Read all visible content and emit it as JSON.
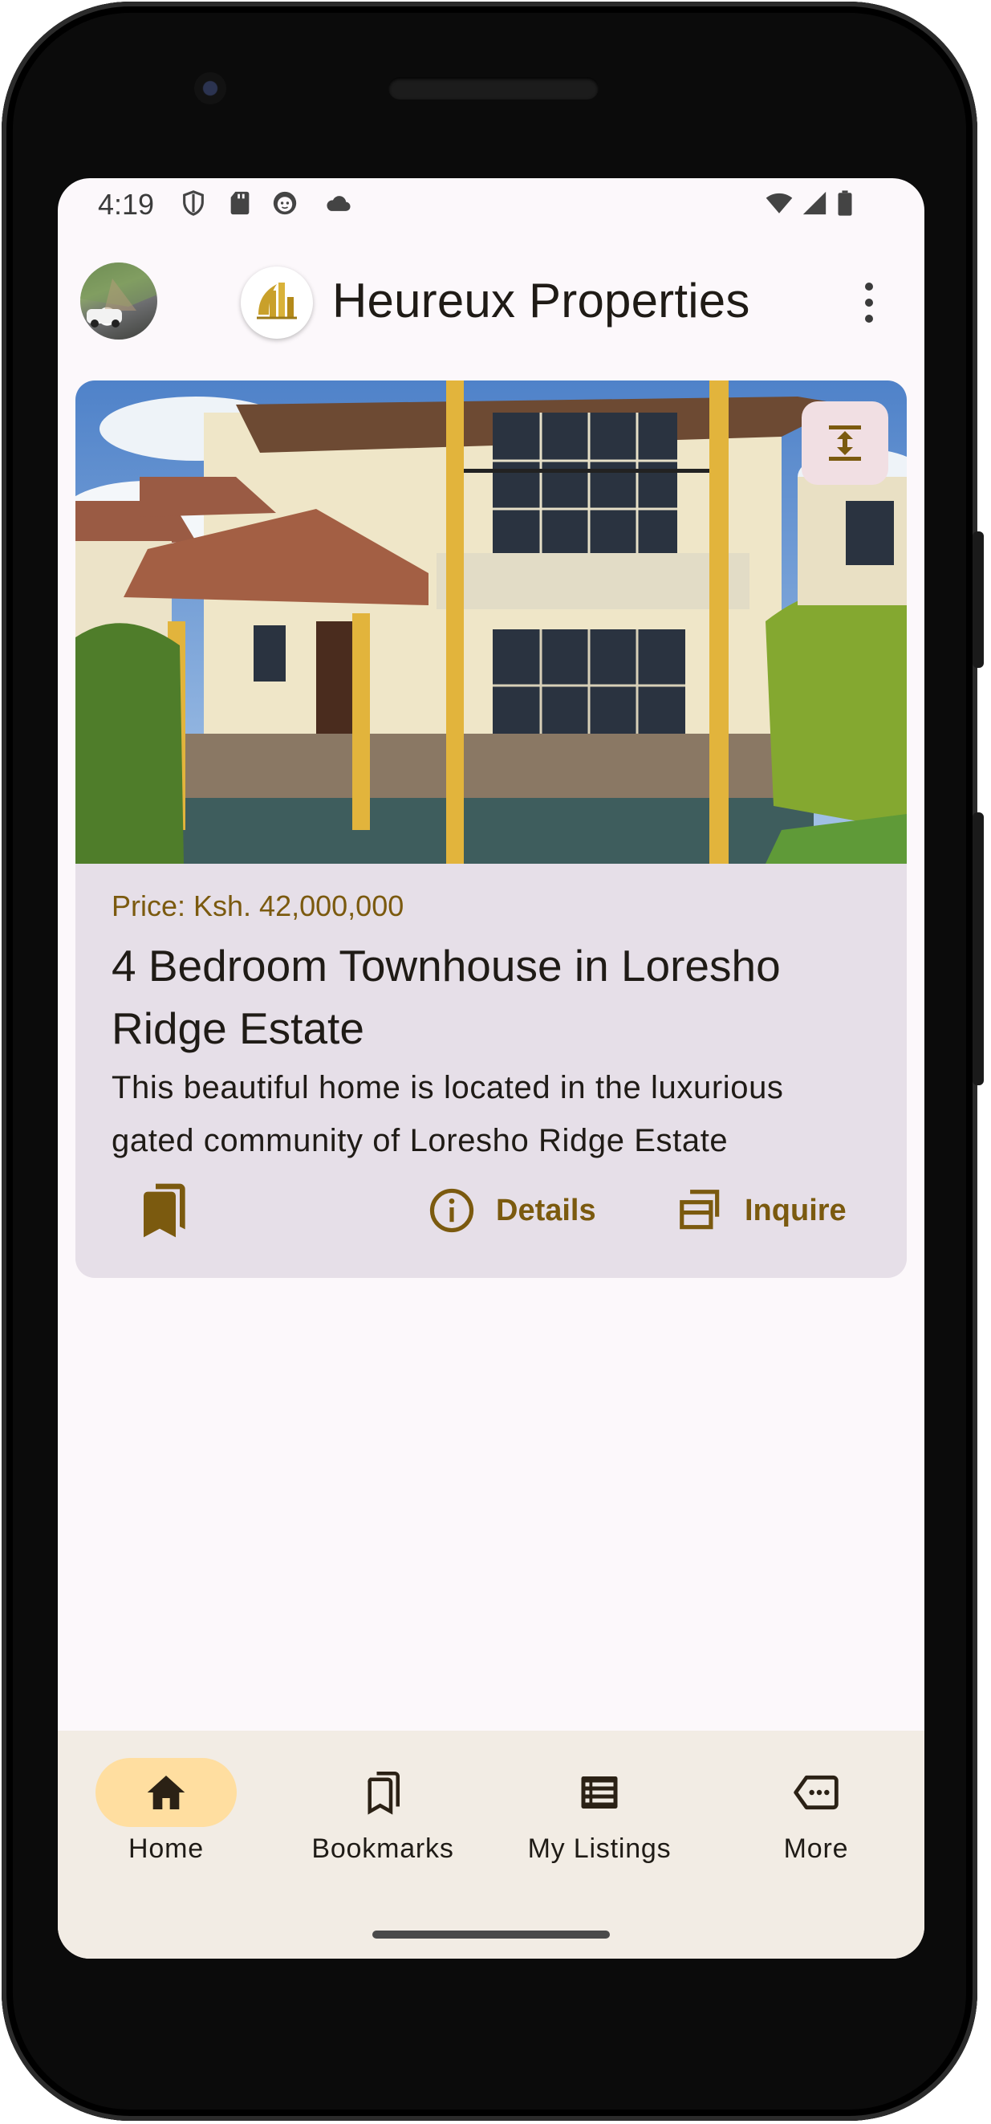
{
  "status_bar": {
    "time": "4:19"
  },
  "app_bar": {
    "title": "Heureux Properties"
  },
  "listing": {
    "price": "Price: Ksh. 42,000,000",
    "title": "4 Bedroom Townhouse in Loresho Ridge Estate",
    "description": "This beautiful home is located in the luxurious gated community of Loresho Ridge Estate",
    "details_label": "Details",
    "inquire_label": "Inquire"
  },
  "bottom_nav": {
    "items": [
      {
        "label": "Home",
        "icon": "home-icon",
        "active": true
      },
      {
        "label": "Bookmarks",
        "icon": "bookmarks-icon",
        "active": false
      },
      {
        "label": "My Listings",
        "icon": "list-icon",
        "active": false
      },
      {
        "label": "More",
        "icon": "more-tag-icon",
        "active": false
      }
    ]
  },
  "colors": {
    "accent": "#7b5a0f",
    "card_bg": "#e6dfe8",
    "nav_bg": "#f2ece4",
    "active_pill": "#ffdea0",
    "screen_bg": "#fcf8fb"
  }
}
